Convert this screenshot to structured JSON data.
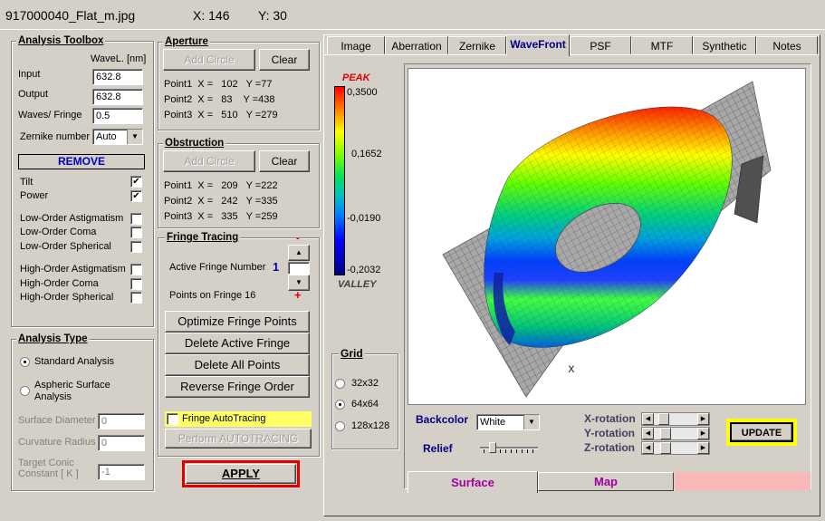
{
  "titlebar": {
    "filename": "917000040_Flat_m.jpg",
    "x_label": "X: 146",
    "y_label": "Y: 30"
  },
  "toolbox": {
    "title": "Analysis Toolbox",
    "wavel_header": "WaveL. [nm]",
    "input_label": "Input",
    "input_value": "632.8",
    "output_label": "Output",
    "output_value": "632.8",
    "waves_label": "Waves/ Fringe",
    "waves_value": "0.5",
    "zernike_label": "Zernike number",
    "zernike_value": "Auto",
    "remove_label": "REMOVE",
    "tilt": "Tilt",
    "power": "Power",
    "low_ast": "Low-Order  Astigmatism",
    "low_coma": "Low-Order  Coma",
    "low_sph": "Low-Order  Spherical",
    "high_ast": "High-Order  Astigmatism",
    "high_coma": "High-Order  Coma",
    "high_sph": "High-Order  Spherical",
    "check_mark": "✔"
  },
  "analysis_type": {
    "title": "Analysis Type",
    "standard": "Standard  Analysis",
    "aspheric1": "Aspheric  Surface",
    "aspheric2": "Analysis",
    "surf_diam": "Surface Diameter",
    "surf_diam_value": "0",
    "curv_radius": "Curvature Radius",
    "curv_radius_value": "0",
    "conic1": "Target Conic",
    "conic2": "Constant [ K ]",
    "conic_value": "-1"
  },
  "aperture": {
    "title": "Aperture",
    "add": "Add Circle",
    "clear": "Clear",
    "p1": "Point1  X =   102   Y =77",
    "p2": "Point2  X =   83    Y =438",
    "p3": "Point3  X =   510   Y =279"
  },
  "obstruction": {
    "title": "Obstruction",
    "add": "Add Circle",
    "clear": "Clear",
    "p1": "Point1  X =   209   Y =222",
    "p2": "Point2  X =   242   Y =335",
    "p3": "Point3  X =   335   Y =259"
  },
  "fringe": {
    "title": "Fringe Tracing",
    "active_label": "Active Fringe Number",
    "active_value": "1",
    "minus": "-",
    "plus": "+",
    "points_label": "Points on  Fringe 16",
    "optimize": "Optimize Fringe Points",
    "delete_active": "Delete Active Fringe",
    "delete_all": "Delete  All  Points",
    "reverse": "Reverse  Fringe Order",
    "autotracing": "Fringe AutoTracing",
    "perform": "Perform  AUTOTRACING"
  },
  "apply_label": "APPLY",
  "tabs": [
    "Image",
    "Aberration",
    "Zernike",
    "WaveFront",
    "PSF",
    "MTF",
    "Synthetic",
    "Notes"
  ],
  "colorbar": {
    "peak": "PEAK",
    "valley": "VALLEY",
    "v1": "0,3500",
    "v2": "0,1652",
    "v3": "-0,0190",
    "v4": "-0,2032"
  },
  "grid": {
    "title": "Grid",
    "o1": "32x32",
    "o2": "64x64",
    "o3": "128x128"
  },
  "viewer": {
    "backcolor_label": "Backcolor",
    "backcolor_value": "White",
    "relief_label": "Relief",
    "xrot": "X-rotation",
    "yrot": "Y-rotation",
    "zrot": "Z-rotation",
    "update": "UPDATE",
    "marker": "x"
  },
  "bottom_tabs": {
    "surface": "Surface",
    "map": "Map"
  },
  "colors": {
    "accent_red": "#e00000",
    "highlight_yellow": "#ffff66",
    "tab_pink": "#f8b8b8",
    "navy": "#000080",
    "purple": "#a000a0"
  }
}
